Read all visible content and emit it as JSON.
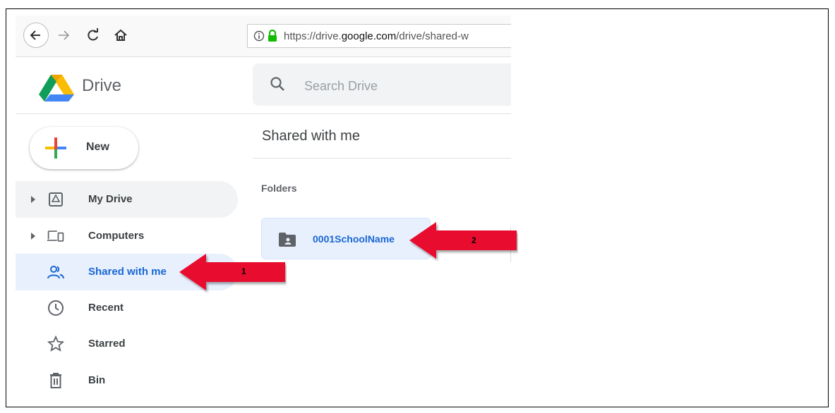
{
  "browser": {
    "url_prefix": "https://drive.",
    "url_host": "google.com",
    "url_suffix": "/drive/shared-w"
  },
  "app": {
    "brand": "Drive"
  },
  "search": {
    "placeholder": "Search Drive"
  },
  "new_button": {
    "label": "New"
  },
  "sidebar": {
    "items": [
      {
        "label": "My Drive",
        "icon": "my-drive-icon"
      },
      {
        "label": "Computers",
        "icon": "computers-icon"
      },
      {
        "label": "Shared with me",
        "icon": "shared-icon",
        "active": true
      },
      {
        "label": "Recent",
        "icon": "clock-icon"
      },
      {
        "label": "Starred",
        "icon": "star-icon"
      },
      {
        "label": "Bin",
        "icon": "bin-icon"
      }
    ]
  },
  "main": {
    "title": "Shared with me",
    "section": "Folders",
    "folders": [
      {
        "name": "0001SchoolName",
        "icon": "shared-folder-icon"
      }
    ]
  },
  "annotations": [
    {
      "number": "1",
      "color": "#e8102e"
    },
    {
      "number": "2",
      "color": "#e8102e"
    }
  ],
  "colors": {
    "accent": "#1967d2",
    "active_bg": "#e8f0fe",
    "arrow": "#e8102e"
  }
}
